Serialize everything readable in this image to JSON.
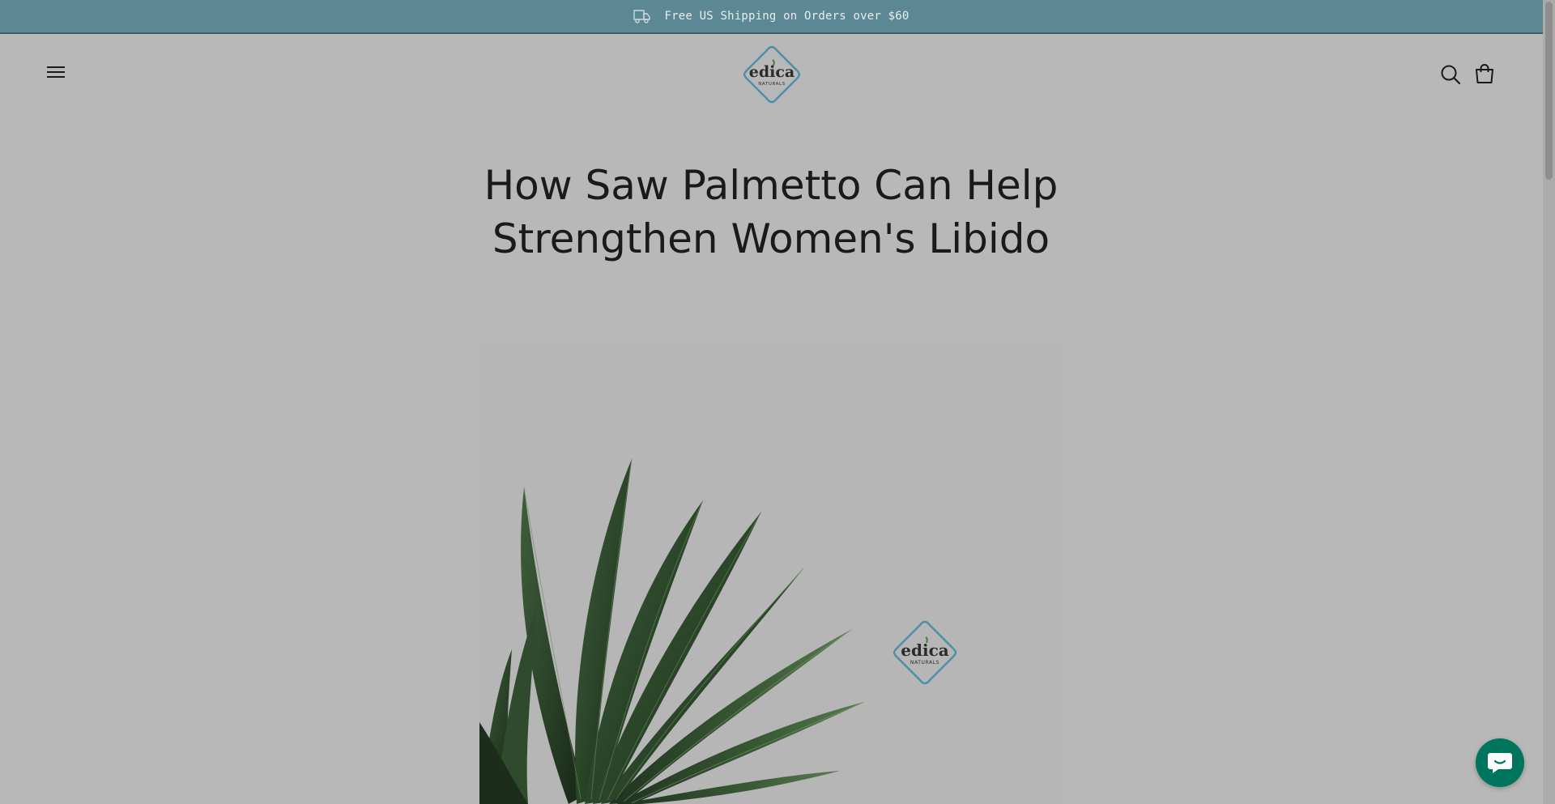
{
  "announcement": {
    "text": "Free US Shipping on Orders over $60",
    "icon": "truck-icon"
  },
  "header": {
    "menu_icon": "hamburger-menu-icon",
    "logo_text": "edica",
    "logo_subtext": "NATURALS",
    "search_icon": "search-icon",
    "cart_icon": "shopping-bag-icon"
  },
  "article": {
    "title": "How Saw Palmetto Can Help Strengthen Women's Libido"
  },
  "featured_image": {
    "logo_text": "edica",
    "logo_subtext": "NATURALS"
  },
  "chat": {
    "icon": "chat-bubble-icon"
  },
  "colors": {
    "announcement_bg": "#5c8896",
    "page_bg": "#b8b8b8",
    "logo_teal": "#4d8fa8",
    "chat_green": "#00755e"
  }
}
